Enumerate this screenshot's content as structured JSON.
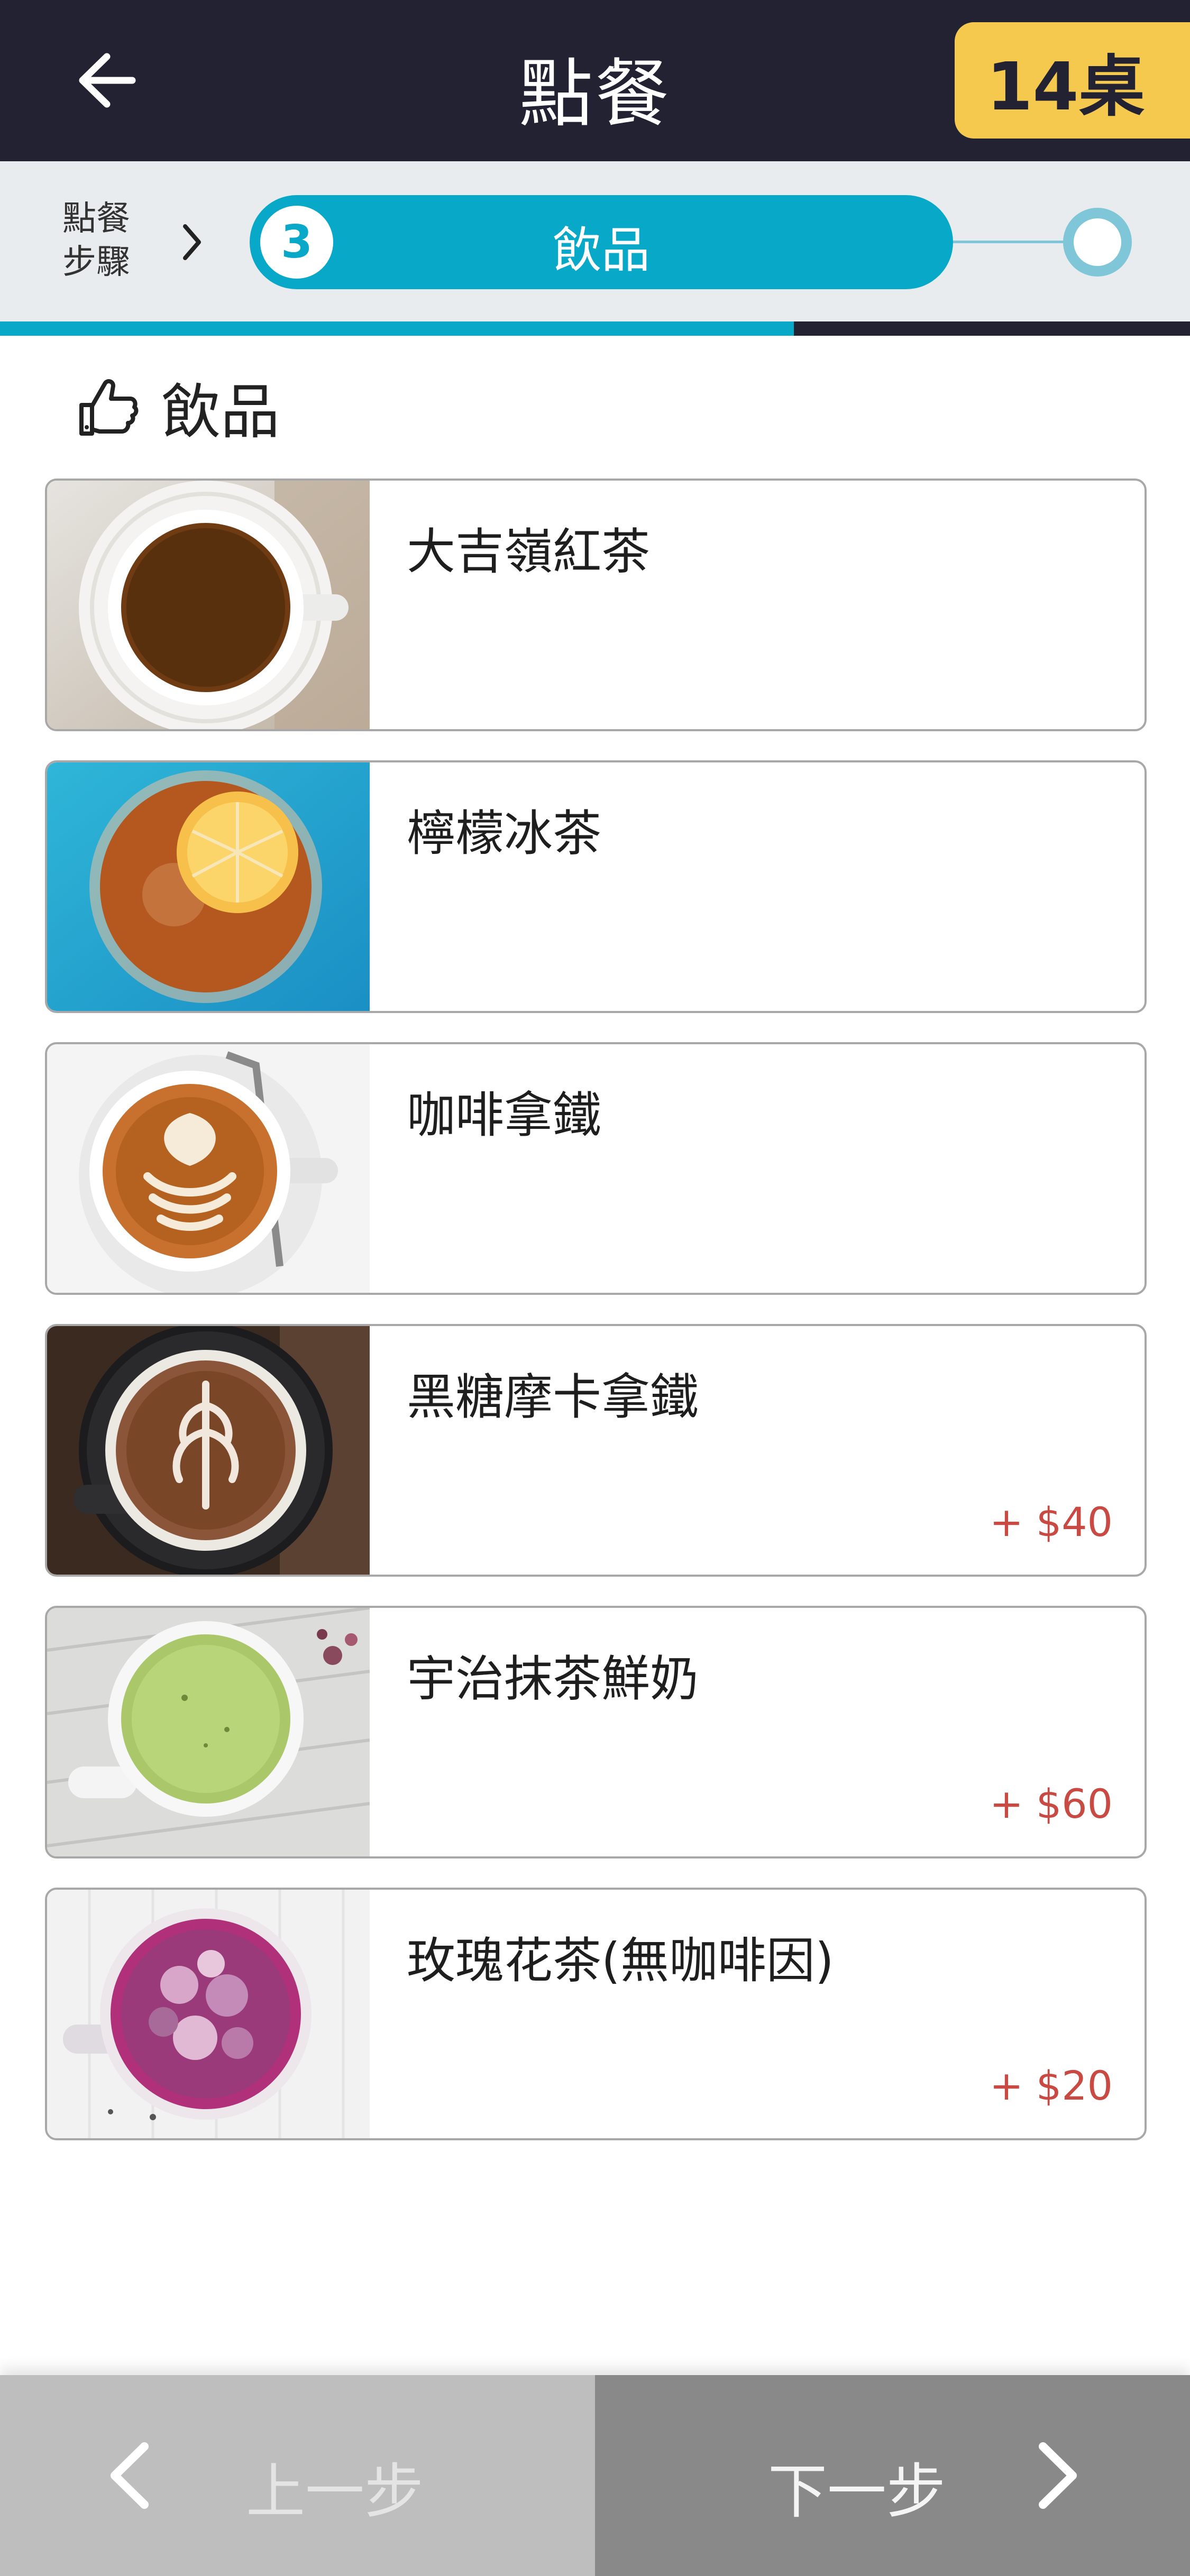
{
  "header": {
    "title": "點餐",
    "table_label": "14桌",
    "back_icon": "arrow-left-icon",
    "colors": {
      "background": "#222233",
      "badge": "#f5c94e"
    }
  },
  "stepper": {
    "label": "點餐\n步驟",
    "current_step_number": "3",
    "current_step_label": "飲品",
    "accent": "#07a8c8",
    "progress_fraction": 0.667
  },
  "section": {
    "icon": "thumbs-point-icon",
    "title": "飲品"
  },
  "items": [
    {
      "name": "大吉嶺紅茶",
      "price": "",
      "image": "black-tea-cup"
    },
    {
      "name": "檸檬冰茶",
      "price": "",
      "image": "iced-lemon-tea"
    },
    {
      "name": "咖啡拿鐵",
      "price": "",
      "image": "cafe-latte"
    },
    {
      "name": "黑糖摩卡拿鐵",
      "price": "+ $40",
      "image": "mocha-latte"
    },
    {
      "name": "宇治抹茶鮮奶",
      "price": "+ $60",
      "image": "matcha-latte"
    },
    {
      "name": "玫瑰花茶(無咖啡因)",
      "price": "+ $20",
      "image": "rose-tea"
    }
  ],
  "price_color": "#c84a42",
  "bottom_nav": {
    "prev_label": "上一步",
    "next_label": "下一步"
  }
}
